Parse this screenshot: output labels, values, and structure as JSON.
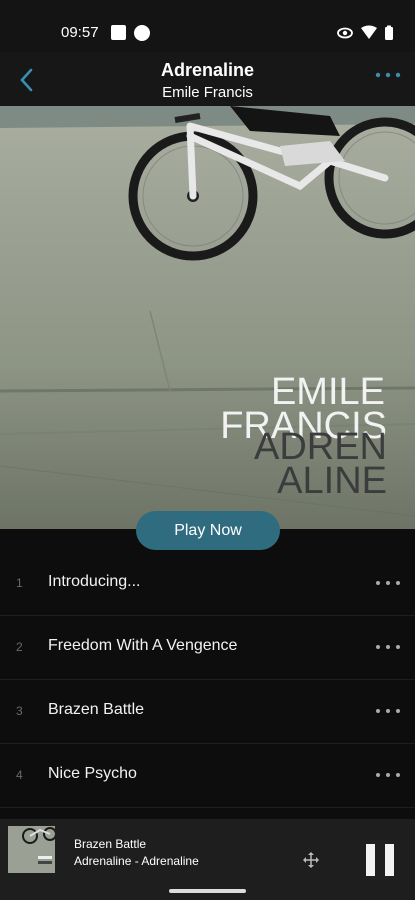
{
  "status_bar": {
    "time": "09:57"
  },
  "header": {
    "title": "Adrenaline",
    "subtitle": "Emile Francis"
  },
  "album_art": {
    "line1": "EMILE",
    "line2": "FRANCIS",
    "line3": "ADREN",
    "line4": "ALINE"
  },
  "play_button": {
    "label": "Play Now"
  },
  "tracks": [
    {
      "number": "1",
      "title": "Introducing..."
    },
    {
      "number": "2",
      "title": "Freedom With A Vengence"
    },
    {
      "number": "3",
      "title": "Brazen Battle"
    },
    {
      "number": "4",
      "title": "Nice Psycho"
    }
  ],
  "mini_player": {
    "title": "Brazen Battle",
    "subtitle": "Adrenaline - Adrenaline"
  },
  "colors": {
    "accent": "#2f6c80",
    "background": "#0d0d0d",
    "header": "#171717"
  },
  "icons": [
    "back-arrow-icon",
    "more-icon",
    "move-icon",
    "pause-icon",
    "eye-icon",
    "wifi-icon",
    "battery-icon"
  ]
}
